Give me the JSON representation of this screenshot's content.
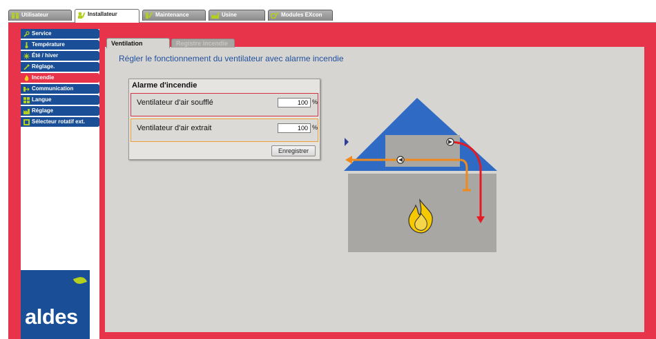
{
  "top_tabs": [
    {
      "label": "Utilisateur",
      "icon": "users-icon"
    },
    {
      "label": "Installateur",
      "icon": "installer-icon"
    },
    {
      "label": "Maintenance",
      "icon": "maintenance-icon"
    },
    {
      "label": "Usine",
      "icon": "factory-icon"
    },
    {
      "label": "Modules EXcon",
      "icon": "modules-icon"
    }
  ],
  "active_top_tab": "Installateur",
  "sidebar": {
    "items": [
      {
        "label": "Service",
        "icon": "tools-icon"
      },
      {
        "label": "Température",
        "icon": "thermometer-icon"
      },
      {
        "label": "Été / hiver",
        "icon": "sun-icon"
      },
      {
        "label": "Réglage.",
        "icon": "wrench-icon"
      },
      {
        "label": "Incendie",
        "icon": "fire-icon"
      },
      {
        "label": "Communication",
        "icon": "communication-icon"
      },
      {
        "label": "Langue",
        "icon": "language-icon"
      },
      {
        "label": "Réglage",
        "icon": "adjust-icon"
      },
      {
        "label": "Sélecteur rotatif ext.",
        "icon": "rotary-selector-icon"
      }
    ],
    "active": "Incendie"
  },
  "logo": {
    "text": "aldes"
  },
  "content_tabs": [
    {
      "label": "Ventilation",
      "active": true
    },
    {
      "label": "Registre incendie",
      "active": false
    }
  ],
  "heading": "Régler le fonctionnement du ventilateur avec alarme incendie",
  "alarm_panel": {
    "title": "Alarme d'incendie",
    "rows": [
      {
        "label": "Ventilateur d'air soufflé",
        "value": "100",
        "unit": "%"
      },
      {
        "label": "Ventilateur d'air extrait",
        "value": "100",
        "unit": "%"
      }
    ],
    "save_label": "Enregistrer"
  },
  "colors": {
    "frame_red": "#e8344b",
    "nav_blue": "#1a4f97",
    "roof_blue": "#2f6bc4",
    "supply_red": "#e41b23",
    "extract_orange": "#f08a1c",
    "logo_green": "#b3cf1f"
  }
}
